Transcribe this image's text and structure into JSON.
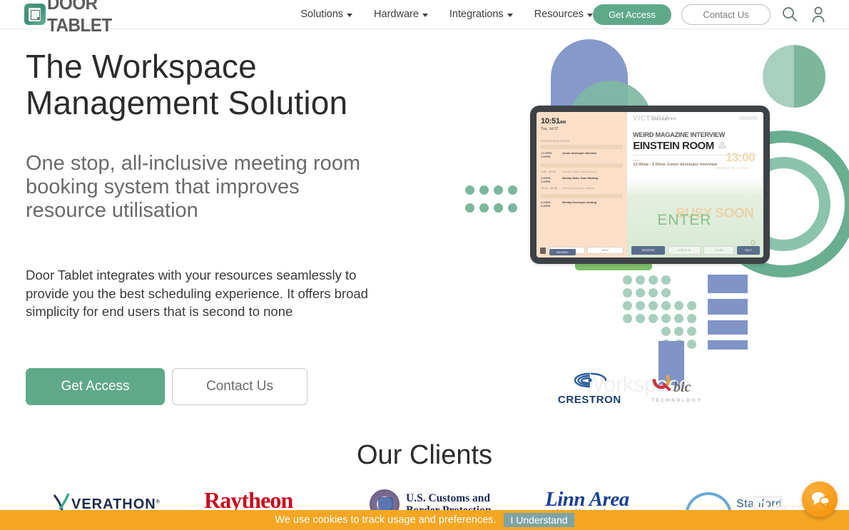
{
  "header": {
    "logo_text": "DOOR TABLET",
    "logo_icon": "door-tablet-logo-icon",
    "nav": [
      {
        "label": "Solutions",
        "icon": "chevron-down-icon"
      },
      {
        "label": "Hardware",
        "icon": "chevron-down-icon"
      },
      {
        "label": "Integrations",
        "icon": "chevron-down-icon"
      },
      {
        "label": "Resources",
        "icon": "chevron-down-icon"
      }
    ],
    "get_access_label": "Get Access",
    "contact_label": "Contact Us",
    "search_icon": "search-icon",
    "account_icon": "user-account-icon"
  },
  "hero": {
    "title_line1": "The Workspace",
    "title_line2": "Management Solution",
    "subtitle": "One stop, all-inclusive meeting room booking system that improves resource utilisation",
    "body": "Door Tablet integrates with your resources seamlessly to provide you the best scheduling experience. It offers broad simplicity for end users that is second to none",
    "cta_primary": "Get Access",
    "cta_secondary": "Contact Us"
  },
  "tablet": {
    "time": "10:51",
    "time_suffix": "AM",
    "date": "Tue, Jul 27",
    "upcoming_label": "Forthcoming events",
    "events": [
      {
        "time": "12:00PM -\n1:00PM",
        "desc": "Junior developer interview"
      },
      {
        "time": "1:00 - 10:00",
        "desc": "Weekly Sales Team Meeting"
      },
      {
        "time": "2:00PM -\n4:00PM",
        "desc": "Weekly Sales Team Meeting"
      },
      {
        "time": "10:30 - 10:30",
        "desc": "Weekly Developer meeting"
      },
      {
        "time": "4:15PM -\n5:45PM",
        "desc": "Weekly Developer meeting"
      }
    ],
    "left_btn_nearby": "NEARBY",
    "left_btn_help": "HELP",
    "ghost_logo": "VICTORIA",
    "logo_placeholder": "Your Logo Here",
    "meeting_title": "WEIRD MAGAZINE INTERVIEW",
    "room_name": "EINSTEIN ROOM",
    "next_label": "Next:",
    "next_time": "12:00ᴀᴍ - 1:00ᴘᴍ",
    "next_desc": "Junior developer interview",
    "ghost_time": "13:00",
    "ending_text": "ENDING IN 1ʜ 25ᴍ",
    "status_busy": "BUSY SOON",
    "status_enter": "ENTER",
    "btn_reserve": "RESERVE",
    "btn_checkin": "CHECK IN",
    "btn_clear": "CLEAR",
    "btn_help": "HELP"
  },
  "partners": {
    "ghost_text": "Workspace",
    "crestron": "CRESTRON",
    "qbic_q": "Q",
    "qbic_bic": "bic",
    "qbic_tech": "TECHNOLOGY"
  },
  "clients": {
    "title": "Our Clients",
    "logos": [
      {
        "name": "Verathon",
        "word": "VERATHON",
        "mark": "⅄"
      },
      {
        "name": "Raytheon",
        "word": "Raytheon"
      },
      {
        "name": "U.S. Customs and Border Protection",
        "line1": "U.S. Customs and",
        "line2": "Border Protection"
      },
      {
        "name": "Linn Area Credit Union",
        "word": "Linn Area",
        "sub": "Credit Union"
      },
      {
        "name": "Stanford Carbon",
        "word": "Stanford"
      }
    ]
  },
  "cookie": {
    "text": "We use cookies to track usage and preferences.",
    "button": "I Understand"
  },
  "watermark": {
    "text": "Revain",
    "glyph": "revain-logo-icon"
  },
  "chat": {
    "icon": "chat-bubbles-icon"
  },
  "colors": {
    "brand_green": "#5fa98a",
    "cookie_orange": "#f5a623",
    "chat_orange": "#f59000",
    "blue_shape": "#8094c8",
    "teal_shape": "#7cb79d"
  }
}
